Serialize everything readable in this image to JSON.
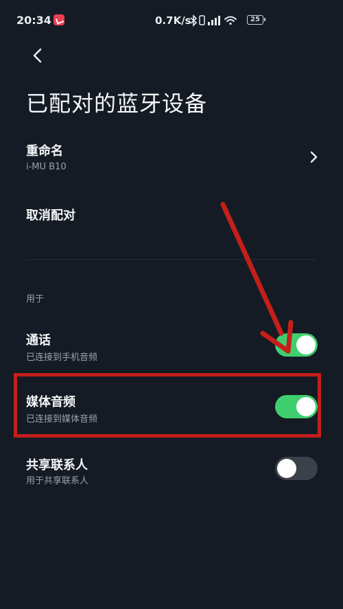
{
  "status_bar": {
    "time": "20:34",
    "net_speed": "0.7K/s",
    "battery": "25"
  },
  "header": {
    "title": "已配对的蓝牙设备"
  },
  "rename": {
    "title": "重命名",
    "value": "i-MU B10"
  },
  "unpair": {
    "title": "取消配对"
  },
  "section": {
    "label": "用于"
  },
  "toggles": [
    {
      "title": "通话",
      "subtitle": "已连接到手机音频",
      "enabled": true
    },
    {
      "title": "媒体音频",
      "subtitle": "已连接到媒体音频",
      "enabled": true
    },
    {
      "title": "共享联系人",
      "subtitle": "用于共享联系人",
      "enabled": false
    }
  ],
  "colors": {
    "background": "#151b24",
    "switch_on": "#3fcf6e",
    "switch_off": "#3a414b",
    "annotation": "#c41f1a"
  },
  "icons": [
    "back-arrow-icon",
    "chevron-right-icon",
    "bluetooth-icon",
    "signal-icon",
    "wifi-icon",
    "battery-icon"
  ]
}
